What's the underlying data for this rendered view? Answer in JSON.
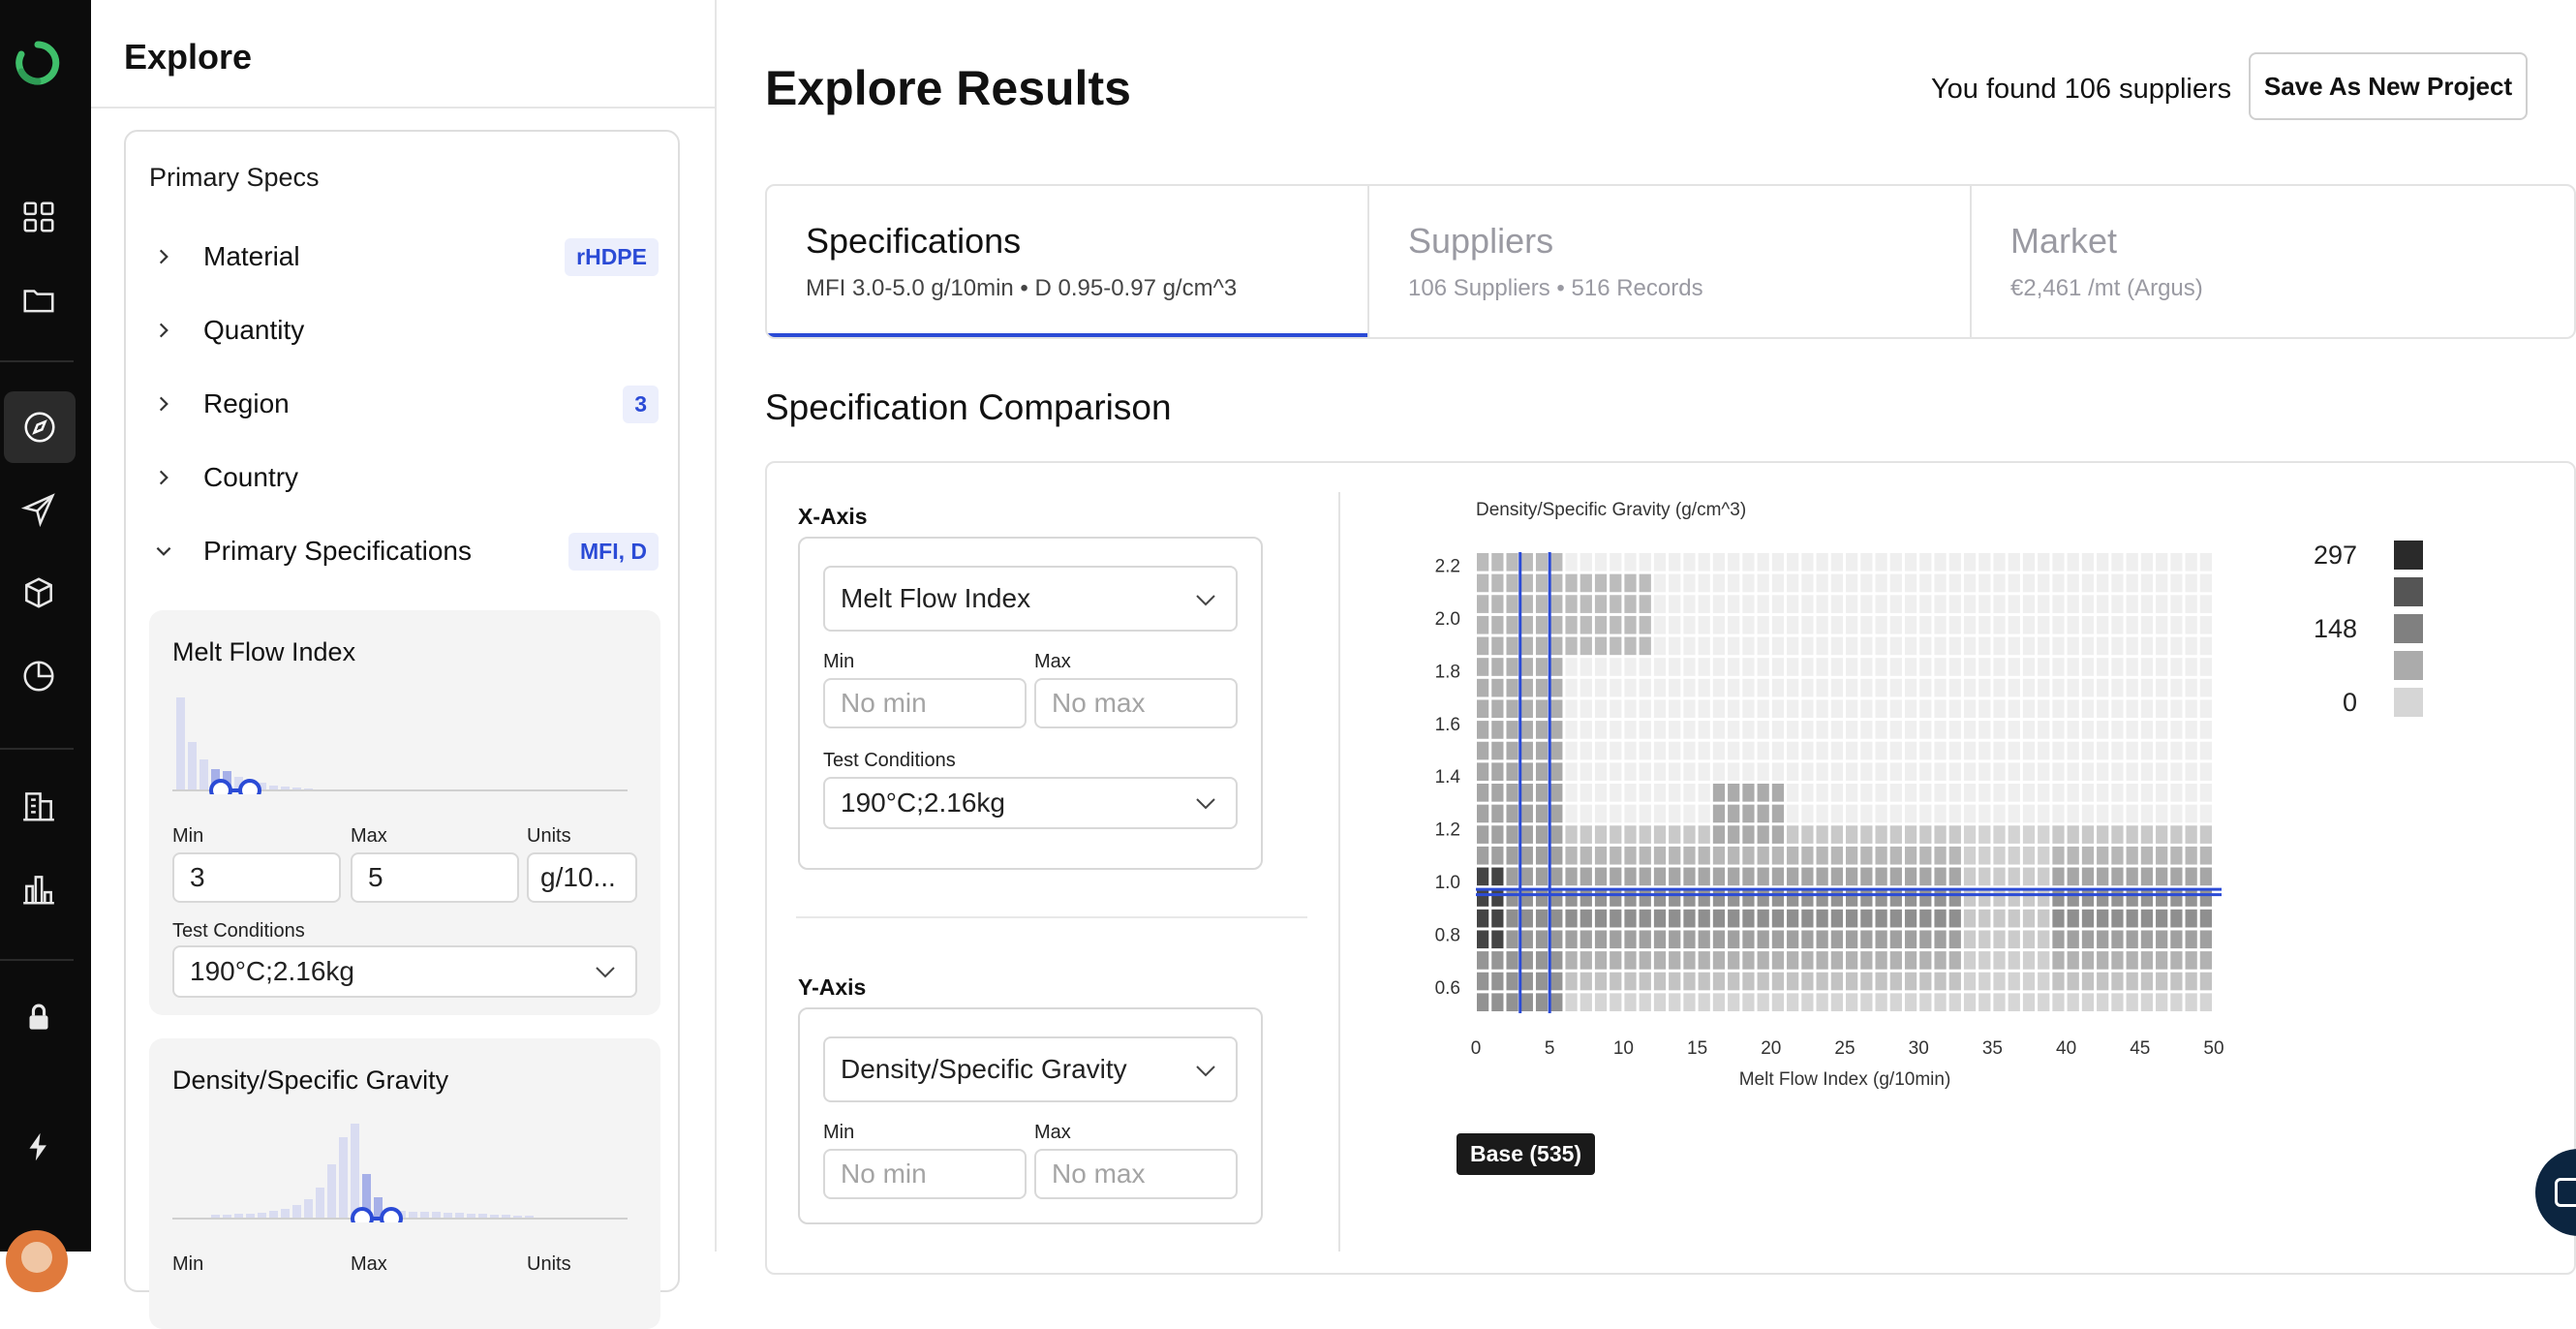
{
  "rail": {
    "icons": [
      "app-logo",
      "dashboard-grid-icon",
      "folder-icon",
      "compass-icon",
      "send-icon",
      "box-icon",
      "pie-chart-icon",
      "building-icon",
      "bar-chart-icon",
      "lock-icon",
      "bolt-icon"
    ],
    "active": "compass-icon"
  },
  "panel": {
    "title": "Explore",
    "card_title": "Primary Specs",
    "accordion": [
      {
        "label": "Material",
        "badge": "rHDPE",
        "expanded": false
      },
      {
        "label": "Quantity",
        "badge": "",
        "expanded": false
      },
      {
        "label": "Region",
        "badge": "3",
        "expanded": false
      },
      {
        "label": "Country",
        "badge": "",
        "expanded": false
      },
      {
        "label": "Primary Specifications",
        "badge": "MFI, D",
        "expanded": true
      }
    ],
    "mfi": {
      "title": "Melt Flow Index",
      "min_label": "Min",
      "max_label": "Max",
      "units_label": "Units",
      "min": "3",
      "max": "5",
      "units": "g/10...",
      "test_label": "Test Conditions",
      "test_value": "190°C;2.16kg"
    },
    "density": {
      "title": "Density/Specific Gravity",
      "min_label": "Min",
      "max_label": "Max",
      "units_label": "Units"
    }
  },
  "main": {
    "title": "Explore Results",
    "found": "You found 106 suppliers",
    "save_button": "Save As New Project",
    "tabs": [
      {
        "label": "Specifications",
        "sub": "MFI 3.0-5.0 g/10min • D 0.95-0.97 g/cm^3",
        "active": true
      },
      {
        "label": "Suppliers",
        "sub": "106 Suppliers • 516 Records",
        "active": false
      },
      {
        "label": "Market",
        "sub": "€2,461 /mt (Argus)",
        "active": false
      }
    ],
    "section_title": "Specification Comparison",
    "x_axis": {
      "heading": "X-Axis",
      "property": "Melt Flow Index",
      "min_label": "Min",
      "max_label": "Max",
      "min_placeholder": "No min",
      "max_placeholder": "No max",
      "test_label": "Test Conditions",
      "test_value": "190°C;2.16kg"
    },
    "y_axis": {
      "heading": "Y-Axis",
      "property": "Density/Specific Gravity",
      "min_label": "Min",
      "max_label": "Max",
      "min_placeholder": "No min",
      "max_placeholder": "No max"
    },
    "base_tooltip": "Base (535)"
  },
  "chart_data": {
    "type": "heatmap",
    "title": "",
    "ylabel": "Density/Specific Gravity (g/cm^3)",
    "xlabel": "Melt Flow Index (g/10min)",
    "xlim": [
      0,
      50
    ],
    "ylim": [
      0.5,
      2.25
    ],
    "x_ticks": [
      0,
      5,
      10,
      15,
      20,
      25,
      30,
      35,
      40,
      45,
      50
    ],
    "y_ticks": [
      0.6,
      0.8,
      1.0,
      1.2,
      1.4,
      1.6,
      1.8,
      2.0,
      2.2
    ],
    "columns": 50,
    "rows": 22,
    "color_scale": {
      "min": 0,
      "mid": 148,
      "max": 297,
      "low_color": "#d6d6d6",
      "high_color": "#2a2a2a"
    },
    "legend_labels": [
      "297",
      "148",
      "0"
    ],
    "selection": {
      "x_min": 3,
      "x_max": 5,
      "y_min": 0.95,
      "y_max": 0.97,
      "color": "#2b4bd6"
    }
  }
}
